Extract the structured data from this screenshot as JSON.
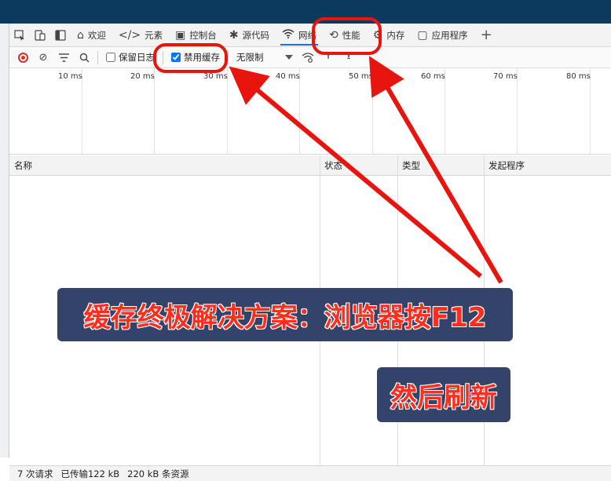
{
  "tabs": [
    {
      "label": "欢迎",
      "icon": "home-icon"
    },
    {
      "label": "元素",
      "icon": "code-icon"
    },
    {
      "label": "控制台",
      "icon": "console-icon"
    },
    {
      "label": "源代码",
      "icon": "bug-icon"
    },
    {
      "label": "网络",
      "icon": "wifi-icon",
      "active": true
    },
    {
      "label": "性能",
      "icon": "performance-icon"
    },
    {
      "label": "内存",
      "icon": "memory-icon"
    },
    {
      "label": "应用程序",
      "icon": "application-icon"
    }
  ],
  "toolbar": {
    "preserve_log_label": "保留日志",
    "preserve_log_checked": false,
    "disable_cache_label": "禁用缓存",
    "disable_cache_checked": true,
    "throttle_value": "无限制"
  },
  "timeline": {
    "ticks": [
      "10 ms",
      "20 ms",
      "30 ms",
      "40 ms",
      "50 ms",
      "60 ms",
      "70 ms",
      "80 ms"
    ]
  },
  "table": {
    "columns": [
      "名称",
      "状态",
      "类型",
      "发起程序"
    ]
  },
  "status": {
    "requests": "7 次请求",
    "transferred": "已传输122 kB",
    "resources": "220 kB 条资源"
  },
  "annotation": {
    "banner_main": "缓存终极解决方案：浏览器按F12",
    "banner_sub": "然后刷新",
    "color": "#e8150f"
  }
}
